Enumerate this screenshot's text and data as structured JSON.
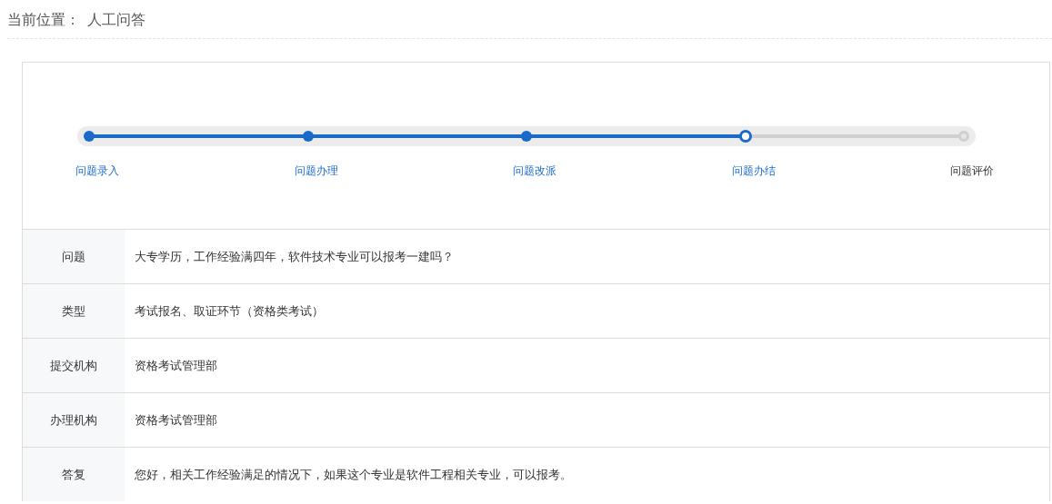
{
  "breadcrumb": {
    "label": "当前位置：",
    "current": "人工问答"
  },
  "steps": [
    {
      "label": "问题录入",
      "completed": true,
      "current": false
    },
    {
      "label": "问题办理",
      "completed": true,
      "current": false
    },
    {
      "label": "问题改派",
      "completed": true,
      "current": false
    },
    {
      "label": "问题办结",
      "completed": false,
      "current": true
    },
    {
      "label": "问题评价",
      "completed": false,
      "current": false
    }
  ],
  "details": [
    {
      "label": "问题",
      "value": "大专学历，工作经验满四年，软件技术专业可以报考一建吗？"
    },
    {
      "label": "类型",
      "value": "考试报名、取证环节（资格类考试）"
    },
    {
      "label": "提交机构",
      "value": "资格考试管理部"
    },
    {
      "label": "办理机构",
      "value": "资格考试管理部"
    },
    {
      "label": "答复",
      "value": "您好，相关工作经验满足的情况下，如果这个专业是软件工程相关专业，可以报考。"
    }
  ]
}
